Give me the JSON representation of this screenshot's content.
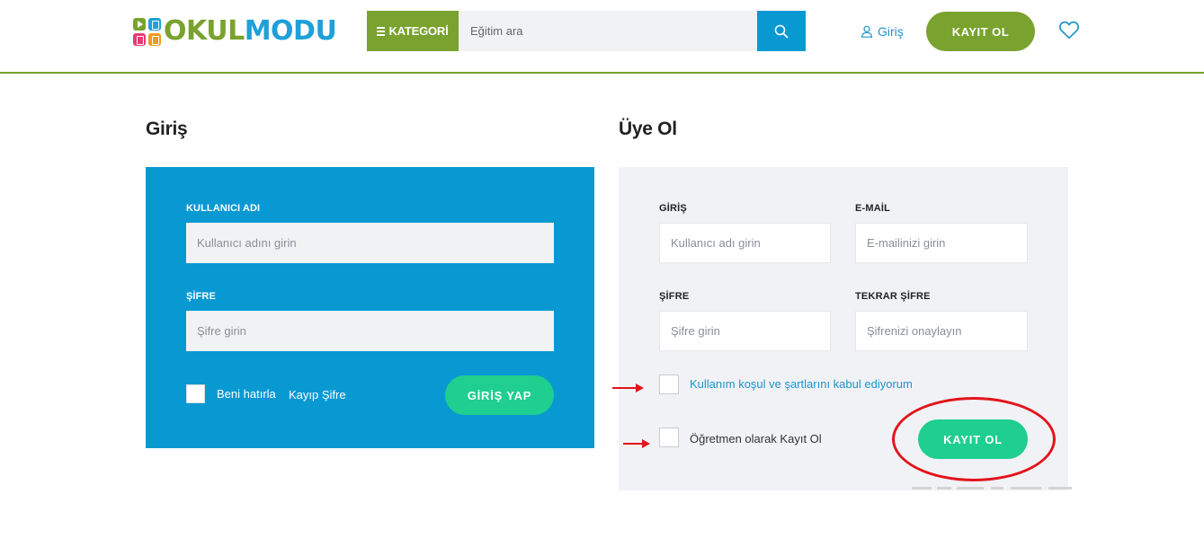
{
  "header": {
    "logo": {
      "part1": "OKUL",
      "part2": "MODU"
    },
    "category_label": "KATEGORİ",
    "search_placeholder": "Eğitim ara",
    "login_label": "Giriş",
    "register_label": "KAYIT OL"
  },
  "login": {
    "title": "Giriş",
    "username_label": "KULLANICI ADI",
    "username_placeholder": "Kullanıcı adını girin",
    "password_label": "ŞİFRE",
    "password_placeholder": "Şifre girin",
    "remember_label": "Beni hatırla",
    "forgot_label": "Kayıp Şifre",
    "submit_label": "GİRİŞ YAP"
  },
  "register": {
    "title": "Üye Ol",
    "username_label": "GİRİŞ",
    "username_placeholder": "Kullanıcı adı girin",
    "email_label": "E-MAİL",
    "email_placeholder": "E-mailinizi girin",
    "password_label": "ŞİFRE",
    "password_placeholder": "Şifre girin",
    "confirm_label": "TEKRAR ŞİFRE",
    "confirm_placeholder": "Şifrenizi onaylayın",
    "terms_label": "Kullanım koşul ve şartlarını kabul ediyorum",
    "teacher_label": "Öğretmen olarak Kayıt Ol",
    "submit_label": "KAYIT OL"
  },
  "colors": {
    "brand_green": "#7aa22f",
    "brand_blue": "#0899d3",
    "button_green": "#1ecf8f",
    "annotation_red": "#e2141b"
  }
}
